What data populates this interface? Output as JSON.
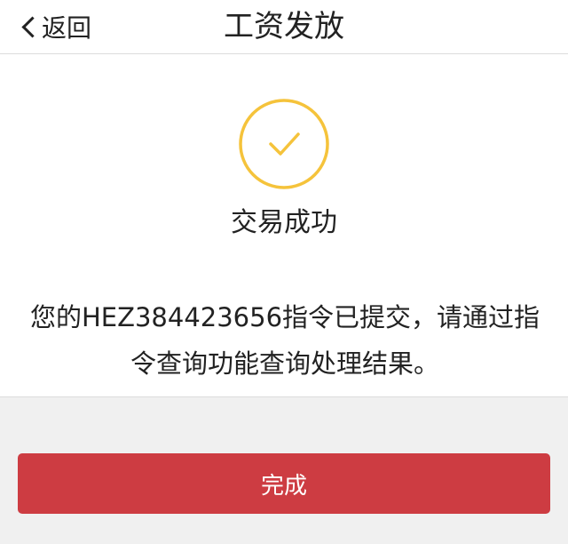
{
  "header": {
    "back_label": "返回",
    "title": "工资发放"
  },
  "result": {
    "icon": "check-circle-icon",
    "icon_color": "#f5c33b",
    "status": "交易成功",
    "message": "您的HEZ384423656指令已提交，请通过指令查询功能查询处理结果。"
  },
  "footer": {
    "done_label": "完成",
    "done_color": "#cd3c42"
  }
}
